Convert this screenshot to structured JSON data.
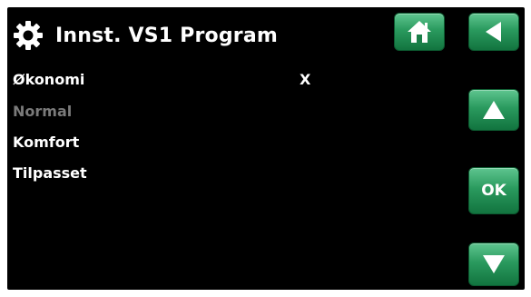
{
  "header": {
    "icon": "gear-icon",
    "title": "Innst. VS1 Program"
  },
  "menu": {
    "items": [
      {
        "label": "Økonomi",
        "state": "enabled"
      },
      {
        "label": "Normal",
        "state": "disabled"
      },
      {
        "label": "Komfort",
        "state": "enabled"
      },
      {
        "label": "Tilpasset",
        "state": "enabled"
      }
    ],
    "selected_marker": "X"
  },
  "buttons": {
    "home": {
      "icon": "home-icon"
    },
    "back": {
      "icon": "back-arrow-icon"
    },
    "up": {
      "icon": "up-arrow-icon"
    },
    "ok": {
      "label": "OK"
    },
    "down": {
      "icon": "down-arrow-icon"
    }
  },
  "colors": {
    "background": "#000000",
    "text": "#ffffff",
    "disabled_text": "#7a7a7a",
    "button_green": "#2a9a5e"
  }
}
